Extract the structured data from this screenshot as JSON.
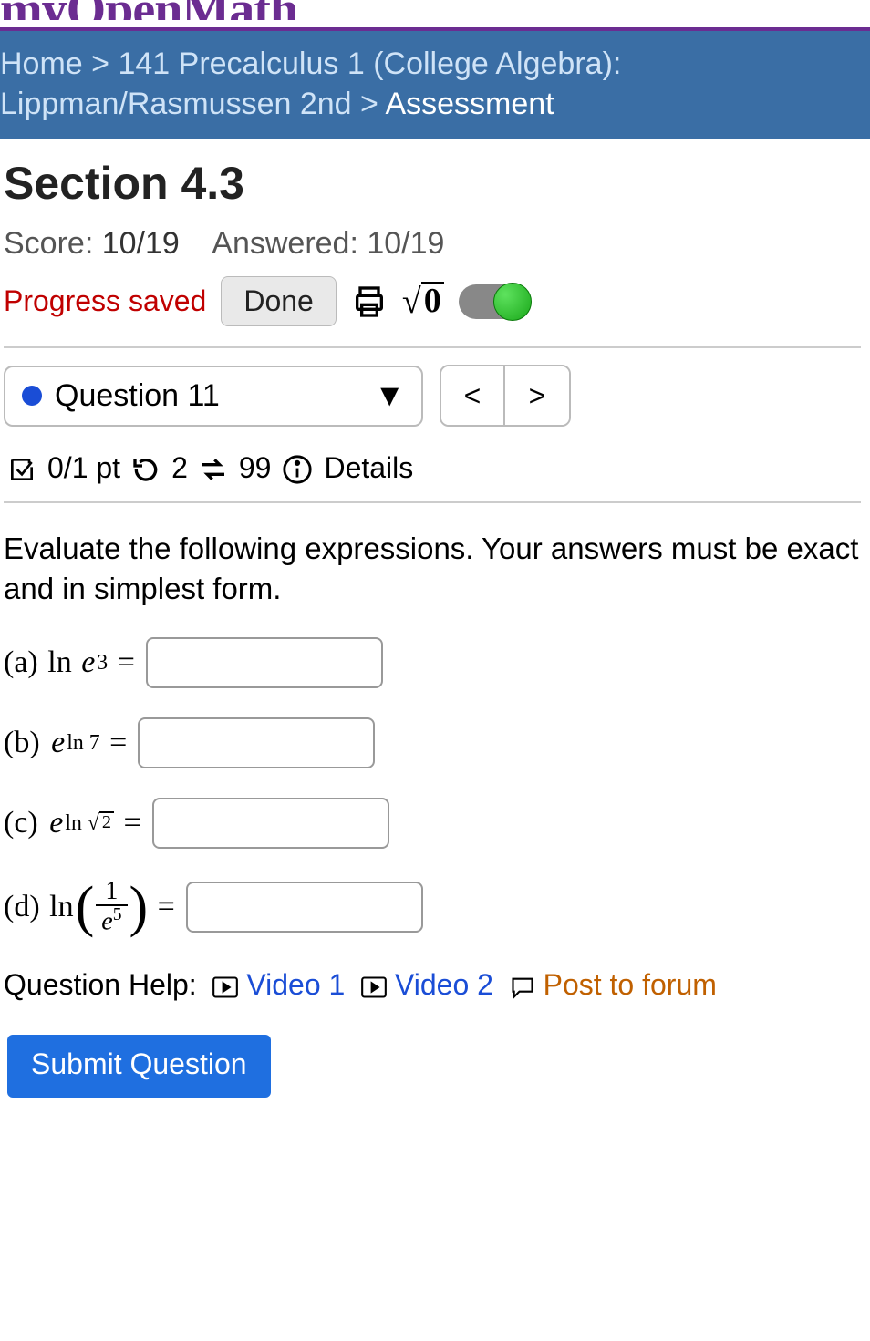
{
  "logo": "myOpenMath",
  "breadcrumb": {
    "home": "Home",
    "course": "141 Precalculus 1 (College Algebra): Lippman/Rasmussen 2nd",
    "current": "Assessment",
    "sep": ">"
  },
  "header": {
    "title": "Section 4.3",
    "score_label": "Score:",
    "score_value": "10/19",
    "answered_label": "Answered:",
    "answered_value": "10/19"
  },
  "progress": {
    "saved_text": "Progress saved",
    "done_label": "Done",
    "sqrt_badge": "√0"
  },
  "qnav": {
    "question_label": "Question 11",
    "prev": "<",
    "next": ">"
  },
  "meta": {
    "points": "0/1 pt",
    "attempts": "2",
    "retries": "99",
    "details": "Details"
  },
  "prompt": "Evaluate the following expressions. Your answers must be exact and in simplest form.",
  "parts": {
    "a": {
      "label": "(a)",
      "expr_html": "ln <i>e</i><sup>3</sup> ="
    },
    "b": {
      "label": "(b)",
      "expr_html": "<i>e</i><sup>ln 7</sup> ="
    },
    "c": {
      "label": "(c)",
      "expr_html": "<i>e</i><sup>ln √2</sup> ="
    },
    "d": {
      "label": "(d)",
      "expr_html": "ln(1/e^5) ="
    }
  },
  "help": {
    "label": "Question Help:",
    "video1": "Video 1",
    "video2": "Video 2",
    "post": "Post to forum"
  },
  "submit": "Submit Question"
}
